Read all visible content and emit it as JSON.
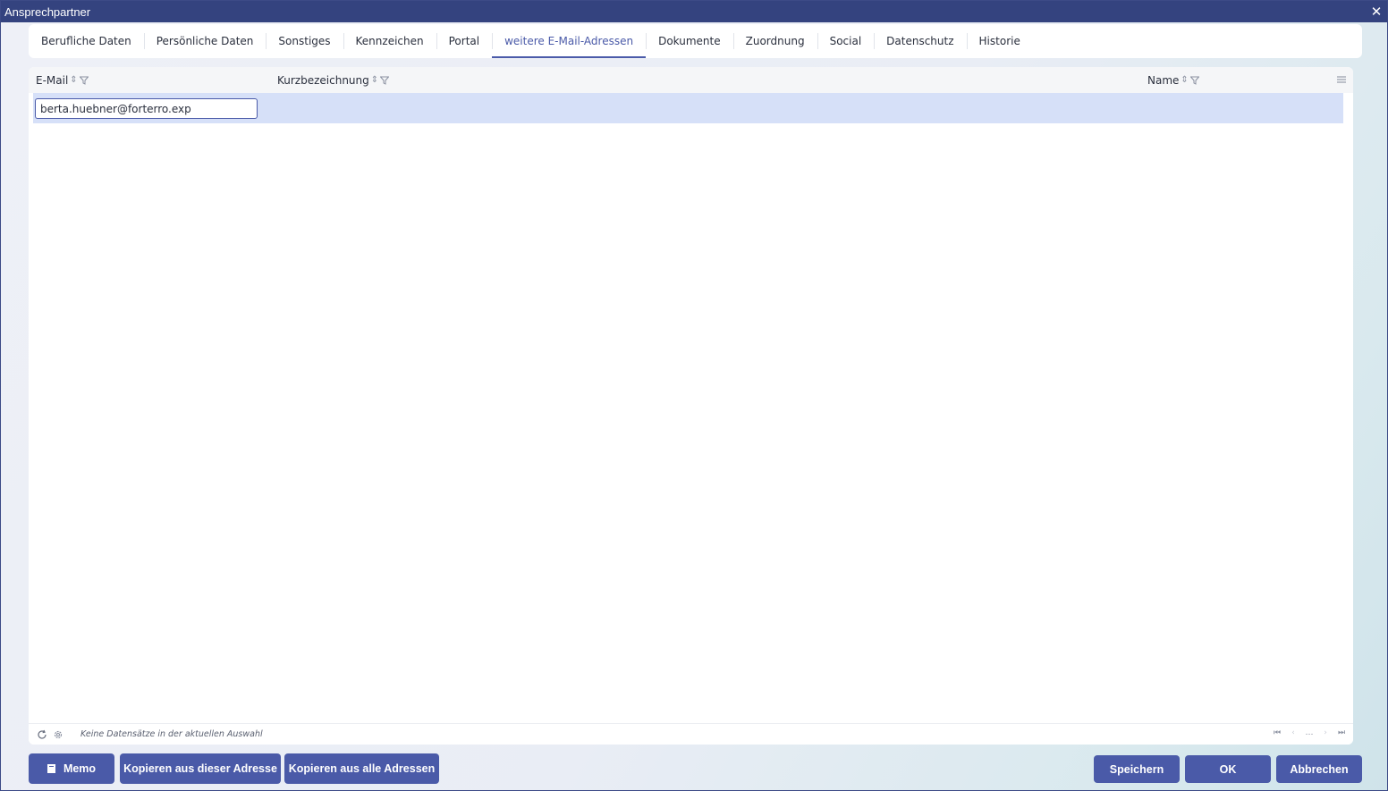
{
  "window": {
    "title": "Ansprechpartner",
    "close_icon": "close-icon"
  },
  "tabs": [
    {
      "label": "Berufliche Daten",
      "active": false
    },
    {
      "label": "Persönliche Daten",
      "active": false
    },
    {
      "label": "Sonstiges",
      "active": false
    },
    {
      "label": "Kennzeichen",
      "active": false
    },
    {
      "label": "Portal",
      "active": false
    },
    {
      "label": "weitere E-Mail-Adressen",
      "active": true
    },
    {
      "label": "Dokumente",
      "active": false
    },
    {
      "label": "Zuordnung",
      "active": false
    },
    {
      "label": "Social",
      "active": false
    },
    {
      "label": "Datenschutz",
      "active": false
    },
    {
      "label": "Historie",
      "active": false
    }
  ],
  "grid": {
    "columns": [
      {
        "label": "E-Mail"
      },
      {
        "label": "Kurzbezeichnung"
      },
      {
        "label": "Name"
      }
    ],
    "rows": [
      {
        "email": "berta.huebner@forterro.exp",
        "kurzbezeichnung": "",
        "name": ""
      }
    ],
    "status": "Keine Datensätze in der aktuellen Auswahl"
  },
  "buttons": {
    "memo": "Memo",
    "copy_this": "Kopieren aus dieser Adresse",
    "copy_all": "Kopieren aus alle Adressen",
    "save": "Speichern",
    "ok": "OK",
    "cancel": "Abbrechen"
  },
  "colors": {
    "accent": "#4a5aa8",
    "titlebar": "#34437f",
    "selected_row": "#d6e0f8"
  }
}
